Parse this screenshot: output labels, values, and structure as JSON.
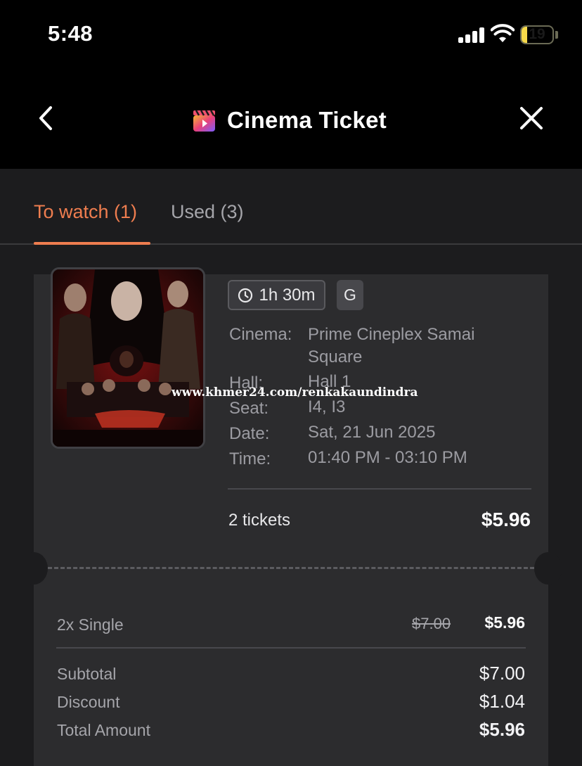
{
  "status_bar": {
    "time": "5:48",
    "battery": "19",
    "battery_level_percent": 19
  },
  "nav": {
    "title": "Cinema Ticket",
    "back_icon": "chevron-left-icon",
    "close_icon": "close-icon",
    "app_icon": "clapperboard-icon"
  },
  "tabs": [
    {
      "label": "To watch (1)",
      "active": true
    },
    {
      "label": "Used (3)",
      "active": false
    }
  ],
  "ticket": {
    "duration": "1h 30m",
    "rating": "G",
    "details": [
      {
        "label": "Cinema:",
        "value": "Prime Cineplex Samai Square"
      },
      {
        "label": "Hall:",
        "value": "Hall 1"
      },
      {
        "label": "Seat:",
        "value": "I4, I3"
      },
      {
        "label": "Date:",
        "value": "Sat, 21 Jun 2025"
      },
      {
        "label": "Time:",
        "value": "01:40 PM - 03:10 PM"
      }
    ],
    "tickets_count": "2 tickets",
    "tickets_price": "$5.96",
    "watermark": "www.khmer24.com/renkakaundindra"
  },
  "breakdown": {
    "item_label": "2x Single",
    "item_original_price": "$7.00",
    "item_price": "$5.96",
    "subtotal_label": "Subtotal",
    "subtotal_value": "$7.00",
    "discount_label": "Discount",
    "discount_value": "$1.04",
    "total_label": "Total Amount",
    "total_value": "$5.96"
  },
  "colors": {
    "accent": "#ee7d4f",
    "background": "#1c1c1e",
    "card": "#2c2c2e",
    "header": "#000000"
  }
}
